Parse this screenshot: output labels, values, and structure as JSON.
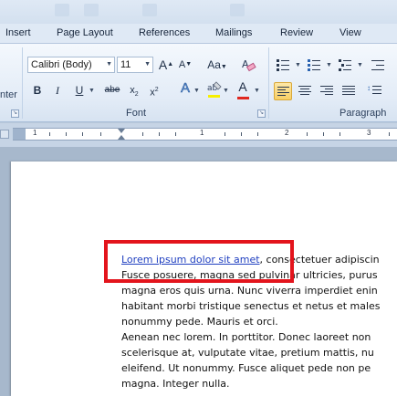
{
  "tabs": [
    "Insert",
    "Page Layout",
    "References",
    "Mailings",
    "Review",
    "View"
  ],
  "ribbon": {
    "font_name": "Calibri (Body)",
    "font_size": "11",
    "grow_font_label": "A",
    "shrink_font_label": "A",
    "change_case_label": "Aa",
    "bold_label": "B",
    "italic_label": "I",
    "underline_label": "U",
    "strikethrough_label": "abe",
    "subscript_label": "x",
    "superscript_label": "x",
    "text_effects_label": "A",
    "font_color_label": "A",
    "left_partial_label": "nter",
    "font_group_label": "Font",
    "paragraph_group_label": "Paragraph"
  },
  "ruler": {
    "numbers": [
      "1",
      "1",
      "2",
      "3"
    ]
  },
  "document": {
    "link_text": "Lorem ipsum dolor sit amet",
    "line1_rest": ", consectetuer adipiscin",
    "lines": [
      "Fusce posuere, magna sed pulvinar ultricies, purus",
      "magna eros quis urna. Nunc viverra imperdiet enin",
      "habitant morbi tristique senectus et netus et males",
      "nonummy pede. Mauris et orci.",
      "Aenean nec lorem. In porttitor. Donec laoreet non",
      "scelerisque at, vulputate vitae, pretium mattis, nu",
      "eleifend. Ut nonummy. Fusce aliquet pede non pe",
      "magna. Integer nulla."
    ]
  },
  "colors": {
    "accent_highlight": "#e3141c",
    "link": "#1f3fc0",
    "font_color": "#e0281f",
    "active_align": "#f8cf65"
  },
  "icons": [
    "grow-font-icon",
    "shrink-font-icon",
    "change-case-icon",
    "clear-format-icon",
    "bullets-icon",
    "numbering-icon",
    "multilevel-list-icon",
    "text-effects-icon",
    "highlight-icon",
    "font-color-icon",
    "align-left-icon",
    "center-icon",
    "align-right-icon",
    "justify-icon"
  ]
}
